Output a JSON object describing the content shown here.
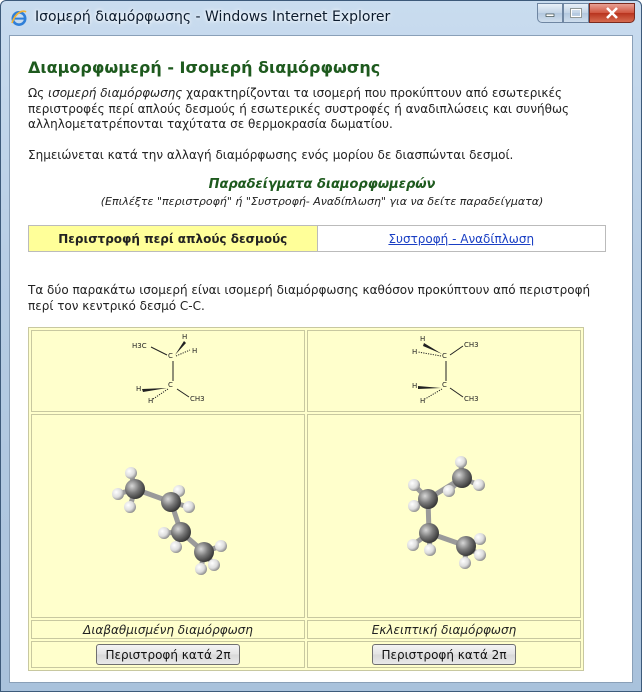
{
  "window": {
    "title": "Ισομερή διαμόρφωσης - Windows Internet Explorer",
    "icon": "ie-icon",
    "controls": [
      "minimize-icon",
      "maximize-icon",
      "close-icon"
    ]
  },
  "page": {
    "heading": "Διαμορφωμερή - Ισομερή διαμόρφωσης",
    "intro_italic": "ισομερή διαμόρφωσης",
    "intro_pre": "Ως ",
    "intro_post": " χαρακτηρίζονται τα ισομερή που προκύπτουν από εσωτερικές περιστροφές περί απλούς δεσμούς ή εσωτερικές συστροφές ή αναδιπλώσεις και συνήθως αλληλομετατρέπονται ταχύτατα σε θερμοκρασία δωματίου.",
    "note": "Σημειώνεται κατά την αλλαγή διαμόρφωσης ενός μορίου δε διασπώνται δεσμοί.",
    "examples_title": "Παραδείγματα διαμορφωμερών",
    "examples_hint": "(Επιλέξτε \"περιστροφή\" ή \"Συστροφή- Αναδίπλωση\" για να δείτε παραδείγματα)",
    "tabs": [
      {
        "label": "Περιστροφή περί απλούς δεσμούς",
        "active": true
      },
      {
        "label": "Συστροφή - Αναδίπλωση",
        "active": false
      }
    ],
    "description": "Τα δύο παρακάτω ισομερή είναι ισομερή διαμόρφωσης καθόσον προκύπτουν από περιστροφή περί τον κεντρικό δεσμό C-C.",
    "conformers": [
      {
        "caption": "Διαβαθμισμένη διαμόρφωση",
        "button": "Περιστροφή κατά 2π",
        "formula_labels": {
          "ch3_top": "H3C",
          "ch3_bottom": "CH3",
          "h": "H",
          "c": "C"
        }
      },
      {
        "caption": "Εκλειπτική διαμόρφωση",
        "button": "Περιστροφή κατά 2π",
        "formula_labels": {
          "ch3_top": "CH3",
          "ch3_bottom": "CH3",
          "h": "H",
          "c": "C"
        }
      }
    ]
  },
  "colors": {
    "heading": "#1e5a1e",
    "active_tab": "#ffff99",
    "panel": "#ffffcc",
    "link": "#1a3fc4"
  }
}
